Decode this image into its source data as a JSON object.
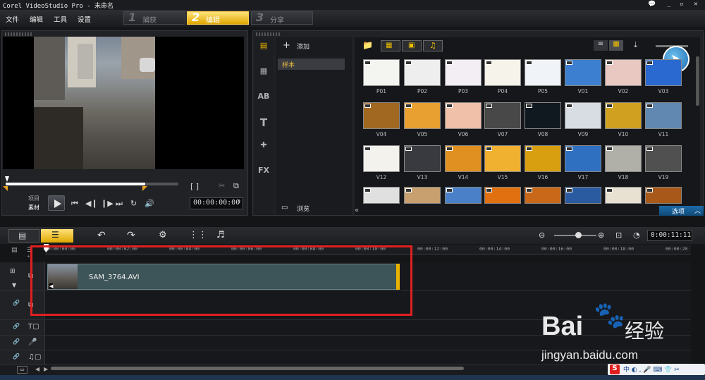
{
  "title": "Corel VideoStudio Pro - 未命名",
  "window_buttons": [
    "💬",
    "_",
    "▫",
    "✕"
  ],
  "menu": [
    "文件",
    "编辑",
    "工具",
    "设置"
  ],
  "steps": [
    {
      "num": "1",
      "label": "捕获"
    },
    {
      "num": "2",
      "label": "编辑"
    },
    {
      "num": "3",
      "label": "分享"
    }
  ],
  "preview": {
    "mode_project": "项目",
    "mode_clip": "素材",
    "timecode": "00:00:00:00",
    "scrub_progress": 0.81,
    "brackets": "[  ]"
  },
  "library": {
    "add_label": "添加",
    "folder_selected": "样本",
    "browse_label": "浏览",
    "options_label": "选项",
    "sidetabs": [
      "▤",
      "▦",
      "AB",
      "T",
      "✚",
      "FX"
    ],
    "thumbs": [
      {
        "id": "P01",
        "c": "#f4f4f0"
      },
      {
        "id": "P02",
        "c": "#eeeeee"
      },
      {
        "id": "P03",
        "c": "#f2eef4"
      },
      {
        "id": "P04",
        "c": "#f6f4ea"
      },
      {
        "id": "P05",
        "c": "#f0f4f8"
      },
      {
        "id": "V01",
        "c": "#3c7fd0"
      },
      {
        "id": "V02",
        "c": "#e8c8c0"
      },
      {
        "id": "V03",
        "c": "#2a6ad0"
      },
      {
        "id": "V04",
        "c": "#a06820"
      },
      {
        "id": "V05",
        "c": "#e8a030"
      },
      {
        "id": "V06",
        "c": "#f0c0a8"
      },
      {
        "id": "V07",
        "c": "#484848"
      },
      {
        "id": "V08",
        "c": "#101820"
      },
      {
        "id": "V09",
        "c": "#d8dde4"
      },
      {
        "id": "V10",
        "c": "#d0a020"
      },
      {
        "id": "V11",
        "c": "#6088b0"
      },
      {
        "id": "V12",
        "c": "#f4f2ec"
      },
      {
        "id": "V13",
        "c": "#383a40"
      },
      {
        "id": "V14",
        "c": "#e09020"
      },
      {
        "id": "V15",
        "c": "#f0b030"
      },
      {
        "id": "V16",
        "c": "#d8a010"
      },
      {
        "id": "V17",
        "c": "#3070c0"
      },
      {
        "id": "V18",
        "c": "#b0b0a8"
      },
      {
        "id": "V19",
        "c": "#505050"
      },
      {
        "id": "",
        "c": "#e0e0e0"
      },
      {
        "id": "",
        "c": "#c8a070"
      },
      {
        "id": "",
        "c": "#4a80c8"
      },
      {
        "id": "",
        "c": "#e07010"
      },
      {
        "id": "",
        "c": "#c86818"
      },
      {
        "id": "",
        "c": "#2a5aa0"
      },
      {
        "id": "",
        "c": "#e8e0d0"
      },
      {
        "id": "",
        "c": "#a85818"
      }
    ]
  },
  "timeline": {
    "timecode": "0:00:11:11",
    "ruler": [
      "00:00:00:00",
      "00:00:02:00",
      "00:00:04:00",
      "00:00:06:00",
      "00:00:08:00",
      "00:00:10:00",
      "00:00:12:00",
      "00:00:14:00",
      "00:00:16:00",
      "00:00:18:00",
      "00:00:20"
    ],
    "clip_name": "SAM_3764.AVI"
  },
  "watermark": {
    "brand": "Bai",
    "brand2": "经验",
    "url": "jingyan.baidu.com"
  },
  "ime": "中 ◐ , 🎤 ⌨ 👕 ✂"
}
